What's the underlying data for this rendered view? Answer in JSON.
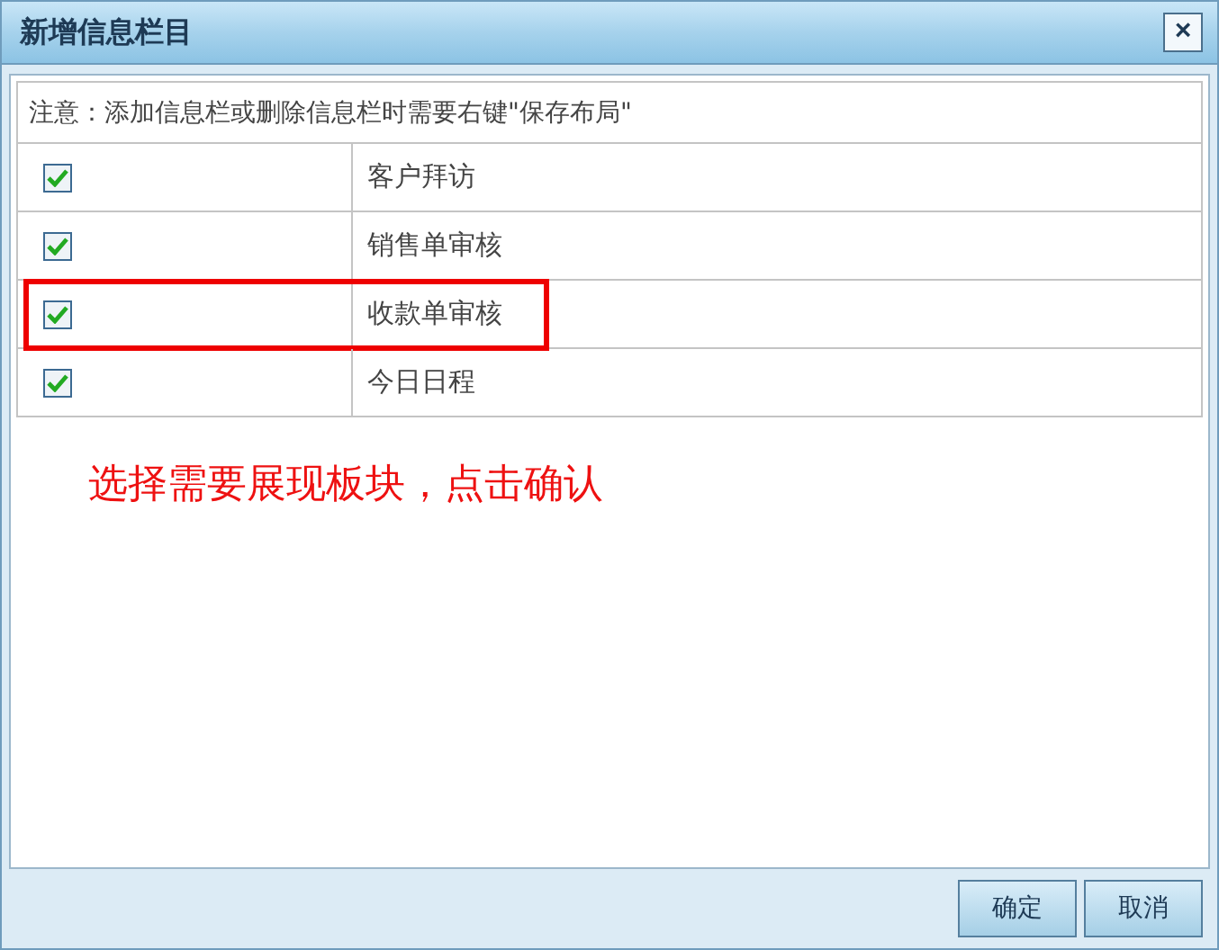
{
  "window": {
    "title": "新增信息栏目",
    "close": "×"
  },
  "notice": "注意：添加信息栏或删除信息栏时需要右键\"保存布局\"",
  "rows": [
    {
      "label": "客户拜访",
      "checked": true,
      "highlighted": false
    },
    {
      "label": "销售单审核",
      "checked": true,
      "highlighted": false
    },
    {
      "label": "收款单审核",
      "checked": true,
      "highlighted": true
    },
    {
      "label": "今日日程",
      "checked": true,
      "highlighted": false
    }
  ],
  "annotation": "选择需要展现板块，点击确认",
  "buttons": [
    "确定",
    "取消"
  ]
}
